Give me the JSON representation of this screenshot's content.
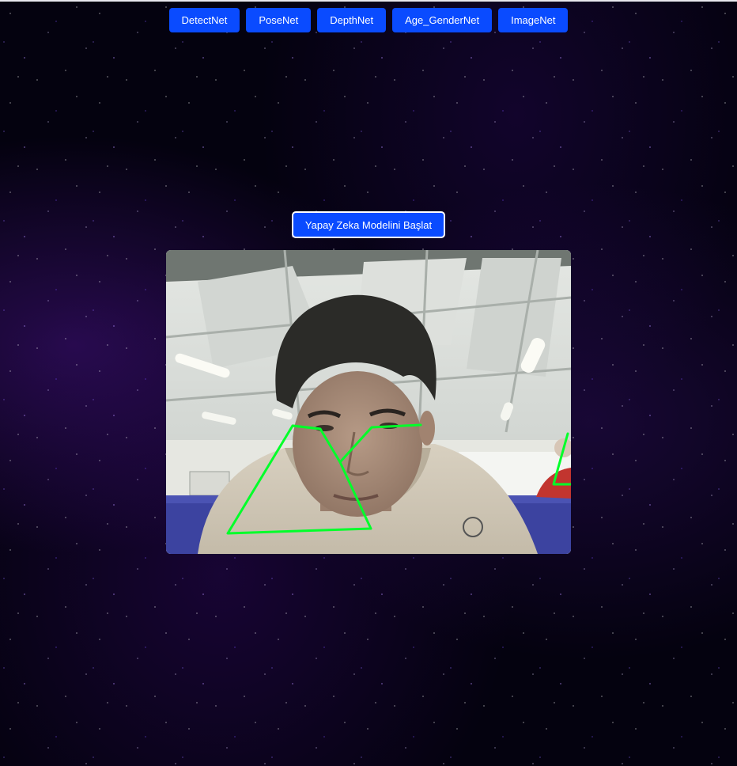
{
  "nav": {
    "buttons": [
      {
        "label": "DetectNet"
      },
      {
        "label": "PoseNet"
      },
      {
        "label": "DepthNet"
      },
      {
        "label": "Age_GenderNet"
      },
      {
        "label": "ImageNet"
      }
    ]
  },
  "start_button": {
    "label": "Yapay Zeka Modelini Başlat"
  },
  "colors": {
    "button": "#0a4bff",
    "pose_overlay": "#00ff2a",
    "background": "#04020f"
  }
}
